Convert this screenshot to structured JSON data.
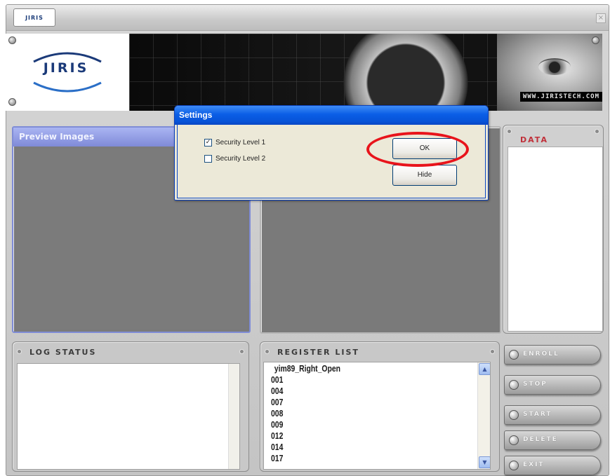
{
  "titlebar": {
    "logo_text": "JIRIS",
    "close_glyph": "×"
  },
  "banner": {
    "brand": "JIRIS",
    "url": "WWW.JIRISTECH.COM"
  },
  "preview_panel": {
    "title": "Preview Images"
  },
  "data_panel": {
    "title": "DATA"
  },
  "log_panel": {
    "title": "LOG STATUS"
  },
  "register_panel": {
    "title": "REGISTER LIST",
    "items": [
      "yim89_Right_Open",
      "001",
      "004",
      "007",
      "008",
      "009",
      "012",
      "014",
      "017"
    ]
  },
  "side_buttons": [
    {
      "label": "ENROLL",
      "icon": "button-orb-icon"
    },
    {
      "label": "STOP",
      "icon": "button-orb-icon"
    },
    {
      "label": "START",
      "icon": "button-orb-icon"
    },
    {
      "label": "DELETE",
      "icon": "button-orb-icon"
    },
    {
      "label": "EXIT",
      "icon": "button-orb-icon"
    }
  ],
  "dialog": {
    "title": "Settings",
    "security_level_1": {
      "label": "Security Level 1",
      "checked": true,
      "mark": "✓"
    },
    "security_level_2": {
      "label": "Security Level 2",
      "checked": false,
      "mark": ""
    },
    "ok_label": "OK",
    "hide_label": "Hide"
  },
  "annotation": {
    "color": "#e8141b",
    "target": "OK"
  },
  "colors": {
    "dialog_title_blue": "#0a5ee6",
    "preview_header": "#8f9ae0",
    "accent_red": "#c0303a"
  }
}
